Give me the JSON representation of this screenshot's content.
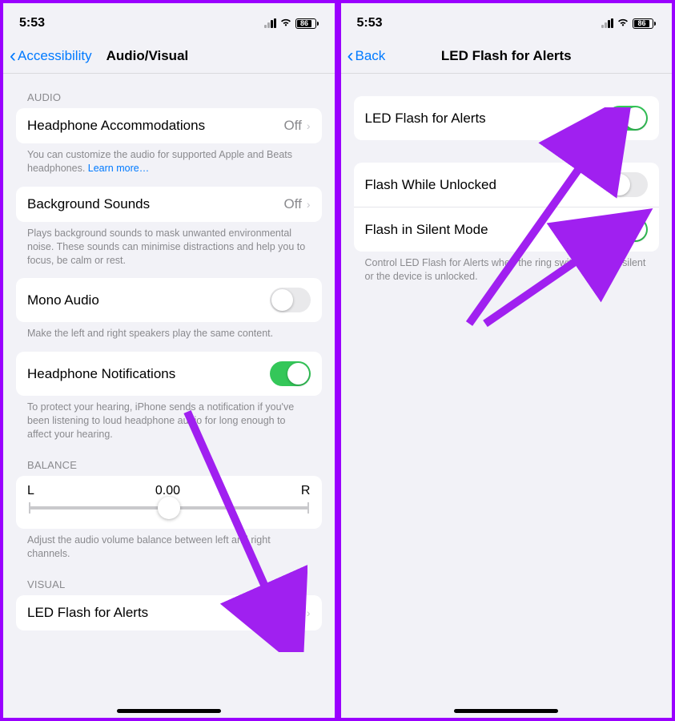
{
  "left": {
    "statusbar": {
      "time": "5:53",
      "battery": "86"
    },
    "nav": {
      "back": "Accessibility",
      "title": "Audio/Visual"
    },
    "sections": {
      "audio_header": "AUDIO",
      "headphone_accom": {
        "label": "Headphone Accommodations",
        "value": "Off"
      },
      "headphone_accom_foot": "You can customize the audio for supported Apple and Beats headphones. ",
      "learn_more": "Learn more…",
      "bg_sounds": {
        "label": "Background Sounds",
        "value": "Off"
      },
      "bg_sounds_foot": "Plays background sounds to mask unwanted environmental noise. These sounds can minimise distractions and help you to focus, be calm or rest.",
      "mono_audio": {
        "label": "Mono Audio"
      },
      "mono_audio_foot": "Make the left and right speakers play the same content.",
      "headphone_notif": {
        "label": "Headphone Notifications"
      },
      "headphone_notif_foot": "To protect your hearing, iPhone sends a notification if you've been listening to loud headphone audio for long enough to affect your hearing.",
      "balance_header": "BALANCE",
      "balance": {
        "l": "L",
        "r": "R",
        "value": "0.00"
      },
      "balance_foot": "Adjust the audio volume balance between left and right channels.",
      "visual_header": "VISUAL",
      "led_flash": {
        "label": "LED Flash for Alerts",
        "value": "On"
      }
    }
  },
  "right": {
    "statusbar": {
      "time": "5:53",
      "battery": "86"
    },
    "nav": {
      "back": "Back",
      "title": "LED Flash for Alerts"
    },
    "rows": {
      "led_flash": {
        "label": "LED Flash for Alerts"
      },
      "flash_unlocked": {
        "label": "Flash While Unlocked"
      },
      "flash_silent": {
        "label": "Flash in Silent Mode"
      }
    },
    "foot": "Control LED Flash for Alerts when the ring switch is set to silent or the device is unlocked."
  }
}
